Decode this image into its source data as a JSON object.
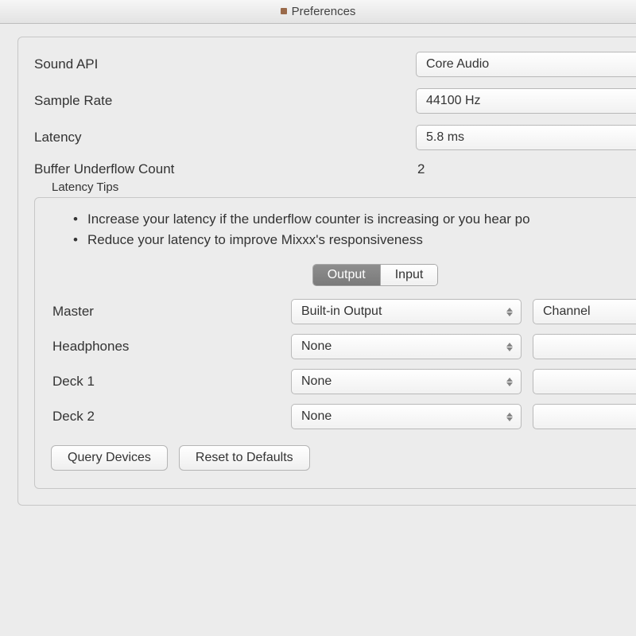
{
  "window": {
    "title": "Preferences"
  },
  "settings": {
    "sound_api": {
      "label": "Sound API",
      "value": "Core Audio"
    },
    "sample_rate": {
      "label": "Sample Rate",
      "value": "44100 Hz"
    },
    "latency": {
      "label": "Latency",
      "value": "5.8 ms"
    },
    "buffer_underflow": {
      "label": "Buffer Underflow Count",
      "value": "2"
    }
  },
  "tips": {
    "title": "Latency Tips",
    "line1": "Increase your latency if the underflow counter is increasing or you hear po",
    "line2": "Reduce your latency to improve Mixxx's responsiveness"
  },
  "tabs": {
    "output": "Output",
    "input": "Input"
  },
  "outputs": {
    "master": {
      "label": "Master",
      "device": "Built-in Output",
      "channel": "Channel"
    },
    "headphones": {
      "label": "Headphones",
      "device": "None",
      "channel": ""
    },
    "deck1": {
      "label": "Deck 1",
      "device": "None",
      "channel": ""
    },
    "deck2": {
      "label": "Deck 2",
      "device": "None",
      "channel": ""
    }
  },
  "buttons": {
    "query": "Query Devices",
    "reset": "Reset to Defaults"
  }
}
